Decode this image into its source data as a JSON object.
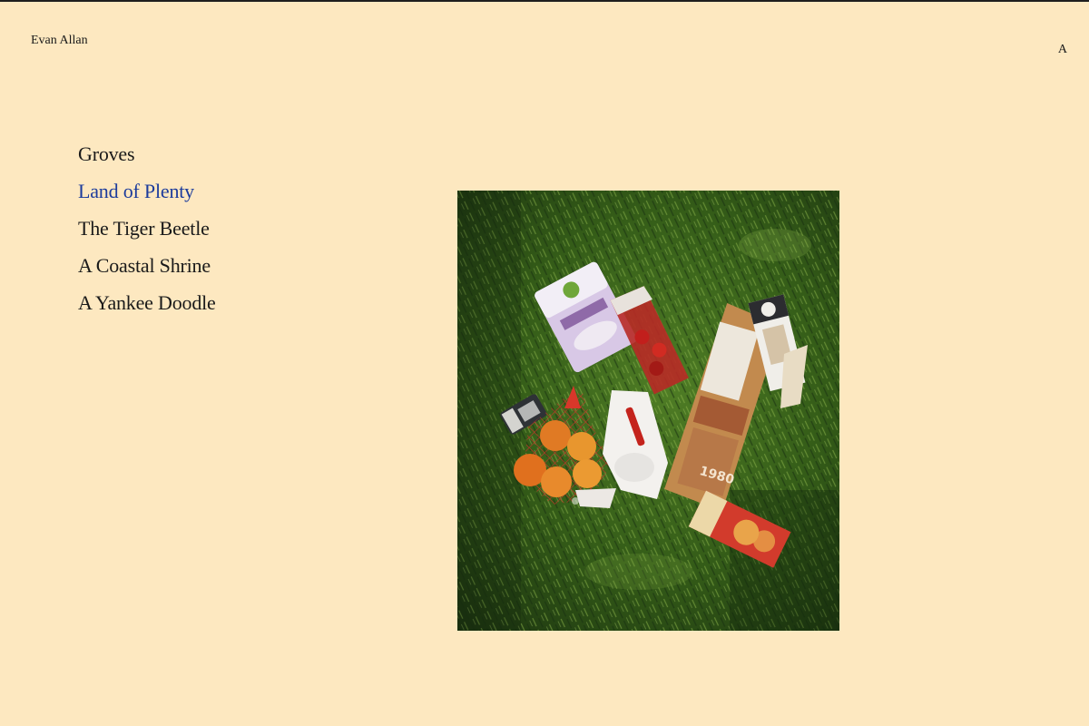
{
  "site": {
    "title": "Evan Allan",
    "menu_toggle": "A"
  },
  "nav": {
    "items": [
      {
        "label": "Groves",
        "active": false
      },
      {
        "label": "Land of Plenty",
        "active": true
      },
      {
        "label": "The Tiger Beetle",
        "active": false
      },
      {
        "label": "A Coastal Shrine",
        "active": false
      },
      {
        "label": "A Yankee Doodle",
        "active": false
      }
    ]
  },
  "photo": {
    "subject": "groceries-on-grass-photo",
    "colors": {
      "grass_dark": "#1f3a12",
      "grass_light": "#5f8d2c",
      "orange": "#e8862a",
      "net": "#d8372a"
    }
  }
}
